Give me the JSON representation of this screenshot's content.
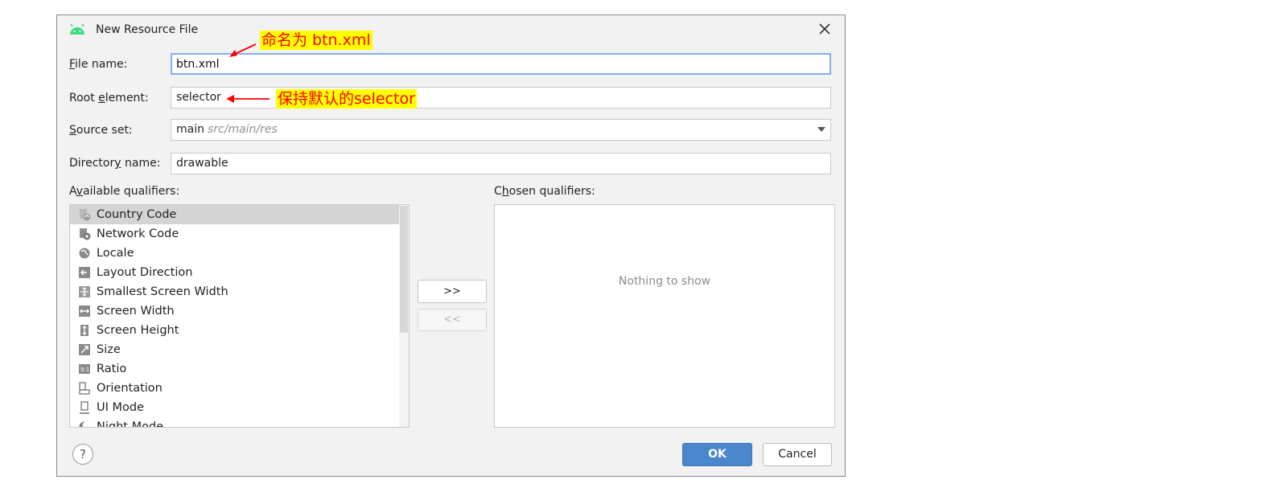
{
  "dialog": {
    "title": "New Resource File",
    "icons": {
      "app": "android-icon",
      "close": "close-icon",
      "help": "help-icon"
    }
  },
  "form": {
    "file_name": {
      "mnemonic": "F",
      "label_rest": "ile name:",
      "value": "btn.xml"
    },
    "root_element": {
      "label_pre": "Root ",
      "mnemonic": "e",
      "label_rest": "lement:",
      "value": "selector"
    },
    "source_set": {
      "mnemonic": "S",
      "label_rest": "ource set:",
      "value": "main",
      "hint": "src/main/res"
    },
    "directory_name": {
      "label_pre": "Director",
      "mnemonic": "y",
      "label_rest": " name:",
      "value": "drawable"
    }
  },
  "available": {
    "label_pre": "A",
    "mnemonic": "v",
    "label_rest": "ailable qualifiers:",
    "items": [
      {
        "label": "Country Code",
        "icon": "country-code-icon"
      },
      {
        "label": "Network Code",
        "icon": "network-code-icon"
      },
      {
        "label": "Locale",
        "icon": "globe-icon"
      },
      {
        "label": "Layout Direction",
        "icon": "layout-direction-icon"
      },
      {
        "label": "Smallest Screen Width",
        "icon": "smallest-width-icon"
      },
      {
        "label": "Screen Width",
        "icon": "screen-width-icon"
      },
      {
        "label": "Screen Height",
        "icon": "screen-height-icon"
      },
      {
        "label": "Size",
        "icon": "size-icon"
      },
      {
        "label": "Ratio",
        "icon": "ratio-icon"
      },
      {
        "label": "Orientation",
        "icon": "orientation-icon"
      },
      {
        "label": "UI Mode",
        "icon": "ui-mode-icon"
      },
      {
        "label": "Night Mode",
        "icon": "night-mode-icon"
      }
    ],
    "selected_index": 0
  },
  "chosen": {
    "label_pre": "C",
    "mnemonic": "h",
    "label_rest": "osen qualifiers:",
    "empty_text": "Nothing to show"
  },
  "buttons": {
    "add": ">>",
    "remove": "<<",
    "ok": "OK",
    "cancel": "Cancel",
    "help": "?"
  },
  "annotations": {
    "file_name_note": "命名为 btn.xml",
    "root_element_note": "保持默认的selector"
  },
  "colors": {
    "accent": "#4a87cc",
    "focus_border": "#86aef0",
    "annotation_bg": "#ffff00",
    "annotation_text": "#ff0000",
    "android_green": "#3ddc84"
  }
}
